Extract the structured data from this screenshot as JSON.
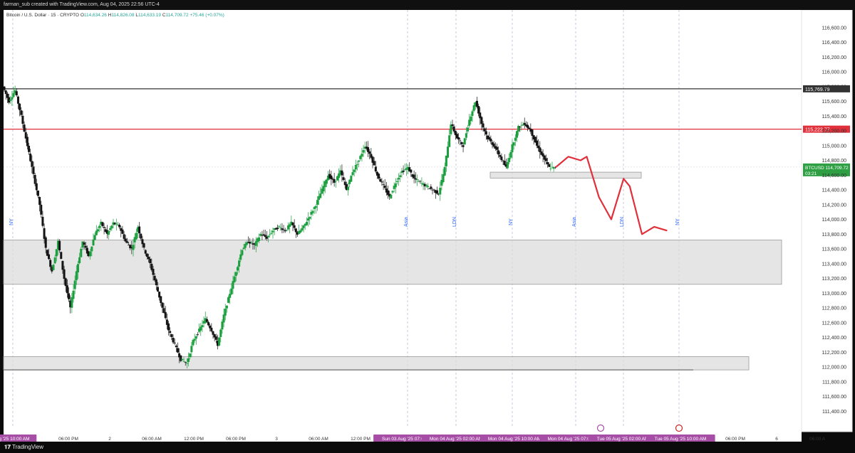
{
  "header": {
    "caption": "farman_sub created with TradingView.com, Aug 04, 2025 22:56 UTC-4"
  },
  "legend": {
    "symbol": "Bitcoin / U.S. Dollar · 15 · CRYPTO",
    "o_label": "O",
    "o_value": "114,634.26",
    "h_label": "H",
    "h_value": "114,826.08",
    "l_label": "L",
    "l_value": "114,633.19",
    "c_label": "C",
    "c_value": "114,709.72",
    "change": "+75.46 (+0.07%)"
  },
  "footer": {
    "logo_text": "TradingView"
  },
  "colors": {
    "background": "#ffffff",
    "up": "#1b9e3e",
    "down": "#141414",
    "resistance_red": "#e0303b",
    "projection_red": "#e0303b",
    "price_badge": "#2ea043",
    "session_badge": "#a64ea6"
  },
  "chart_data": {
    "type": "candlestick",
    "symbol": "BTCUSD",
    "current_price": "114,709.72",
    "countdown": "03:21",
    "ylim": [
      111200,
      116800
    ],
    "y_ticks": [
      "116,600.00",
      "116,400.00",
      "116,200.00",
      "116,000.00",
      "115,800.00",
      "115,600.00",
      "115,400.00",
      "115,200.00",
      "115,000.00",
      "114,800.00",
      "114,600.00",
      "114,400.00",
      "114,200.00",
      "114,000.00",
      "113,800.00",
      "113,600.00",
      "113,400.00",
      "113,200.00",
      "113,000.00",
      "112,800.00",
      "112,600.00",
      "112,400.00",
      "112,200.00",
      "112,000.00",
      "111,800.00",
      "111,600.00",
      "111,400.00"
    ],
    "x_ticks": [
      "Aug '25  10:00 AM",
      "06:00 PM",
      "2",
      "06:00 AM",
      "12:00 PM",
      "06:00 PM",
      "3",
      "06:00 AM",
      "12:00 PM",
      "Sun 03 Aug '25  07:00",
      "Mon 04 Aug '25  02:00 AM",
      "Mon 04 Aug '25  10:00 AM",
      "Mon 04 Aug '25  07:00",
      "Tue 05 Aug '25  02:00 AM",
      "Tue 05 Aug '25  10:00 AM",
      "06:00 PM",
      "6",
      "06:00 A"
    ],
    "sessions": [
      "NY",
      "Asia",
      "LDN",
      "NY",
      "Asia",
      "LDN",
      "NY"
    ],
    "levels": [
      {
        "value": 115769.79,
        "label": "115,769.79",
        "color": "#333333"
      },
      {
        "value": 115222.77,
        "label": "115,222.77",
        "color": "#e0303b"
      }
    ],
    "zones": [
      {
        "from": 114560,
        "to": 114640
      },
      {
        "from": 113120,
        "to": 113720
      },
      {
        "from": 111960,
        "to": 112140
      }
    ],
    "price_path": [
      [
        0,
        115800
      ],
      [
        2,
        115600
      ],
      [
        4,
        115750
      ],
      [
        6,
        115400
      ],
      [
        8,
        115000
      ],
      [
        10,
        114600
      ],
      [
        12,
        114200
      ],
      [
        14,
        113600
      ],
      [
        16,
        113300
      ],
      [
        18,
        113700
      ],
      [
        20,
        113200
      ],
      [
        22,
        112800
      ],
      [
        24,
        113300
      ],
      [
        26,
        113700
      ],
      [
        28,
        113500
      ],
      [
        30,
        113800
      ],
      [
        32,
        113950
      ],
      [
        34,
        113800
      ],
      [
        36,
        113950
      ],
      [
        38,
        113900
      ],
      [
        40,
        113700
      ],
      [
        42,
        113600
      ],
      [
        44,
        113900
      ],
      [
        46,
        113600
      ],
      [
        48,
        113400
      ],
      [
        50,
        113100
      ],
      [
        52,
        112800
      ],
      [
        54,
        112500
      ],
      [
        56,
        112300
      ],
      [
        58,
        112100
      ],
      [
        60,
        112050
      ],
      [
        62,
        112350
      ],
      [
        64,
        112500
      ],
      [
        66,
        112650
      ],
      [
        68,
        112500
      ],
      [
        70,
        112300
      ],
      [
        72,
        112700
      ],
      [
        74,
        113000
      ],
      [
        76,
        113300
      ],
      [
        78,
        113600
      ],
      [
        80,
        113700
      ],
      [
        82,
        113650
      ],
      [
        84,
        113800
      ],
      [
        86,
        113750
      ],
      [
        88,
        113850
      ],
      [
        90,
        113900
      ],
      [
        92,
        113850
      ],
      [
        94,
        113950
      ],
      [
        96,
        113800
      ],
      [
        98,
        113900
      ],
      [
        100,
        114050
      ],
      [
        102,
        114200
      ],
      [
        104,
        114400
      ],
      [
        106,
        114600
      ],
      [
        108,
        114500
      ],
      [
        110,
        114650
      ],
      [
        112,
        114400
      ],
      [
        114,
        114650
      ],
      [
        116,
        114800
      ],
      [
        118,
        115000
      ],
      [
        120,
        114850
      ],
      [
        122,
        114600
      ],
      [
        124,
        114450
      ],
      [
        126,
        114300
      ],
      [
        128,
        114500
      ],
      [
        130,
        114650
      ],
      [
        132,
        114700
      ],
      [
        134,
        114550
      ],
      [
        136,
        114500
      ],
      [
        138,
        114450
      ],
      [
        140,
        114400
      ],
      [
        142,
        114350
      ],
      [
        144,
        114700
      ],
      [
        146,
        115300
      ],
      [
        148,
        115100
      ],
      [
        150,
        115000
      ],
      [
        152,
        115350
      ],
      [
        154,
        115600
      ],
      [
        156,
        115300
      ],
      [
        158,
        115100
      ],
      [
        160,
        115000
      ],
      [
        162,
        114850
      ],
      [
        164,
        114700
      ],
      [
        166,
        115000
      ],
      [
        168,
        115250
      ],
      [
        170,
        115300
      ],
      [
        172,
        115200
      ],
      [
        174,
        115000
      ],
      [
        176,
        114850
      ],
      [
        178,
        114700
      ],
      [
        180,
        114700
      ]
    ],
    "projection": [
      [
        180,
        114709
      ],
      [
        184,
        114850
      ],
      [
        188,
        114800
      ],
      [
        190,
        114850
      ],
      [
        194,
        114300
      ],
      [
        198,
        114000
      ],
      [
        202,
        114550
      ],
      [
        204,
        114450
      ],
      [
        208,
        113800
      ],
      [
        212,
        113900
      ],
      [
        216,
        113850
      ]
    ]
  }
}
